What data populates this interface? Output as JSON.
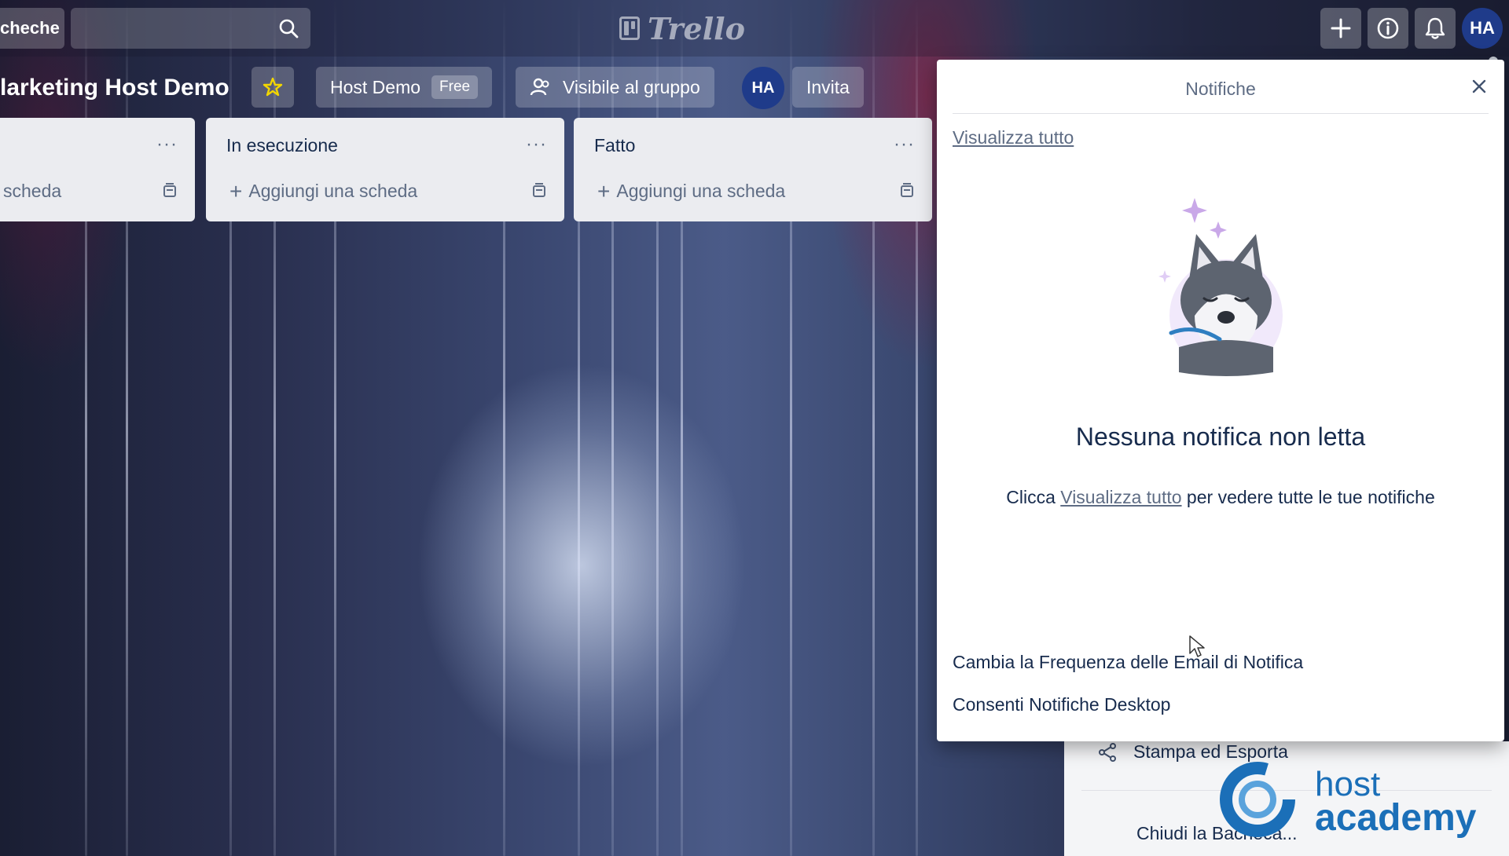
{
  "topbar": {
    "boards_label": "cheche",
    "logo_text": "Trello",
    "avatar_initials": "HA",
    "icons": [
      "search-icon",
      "plus-icon",
      "info-icon",
      "bell-icon"
    ]
  },
  "board": {
    "title": "larketing Host Demo",
    "workspace_label": "Host Demo",
    "workspace_badge": "Free",
    "visibility_label": "Visibile al gruppo",
    "member_initials": "HA",
    "invite_label": "Invita"
  },
  "lists": [
    {
      "title": "",
      "add_card_label": "scheda"
    },
    {
      "title": "In esecuzione",
      "add_card_label": "Aggiungi una scheda"
    },
    {
      "title": "Fatto",
      "add_card_label": "Aggiungi una scheda"
    }
  ],
  "notifications": {
    "title": "Notifiche",
    "view_all": "Visualizza tutto",
    "empty_title": "Nessuna notifica non letta",
    "empty_sub_prefix": "Clicca ",
    "empty_sub_link": "Visualizza tutto",
    "empty_sub_suffix": " per vedere tutte le tue notifiche",
    "option_email_frequency": "Cambia la Frequenza delle Email di Notifica",
    "option_desktop": "Consenti Notifiche Desktop"
  },
  "side_menu": {
    "print_export": "Stampa ed Esporta",
    "close_board": "Chiudi la Bacheca..."
  },
  "watermark": {
    "line1": "host",
    "line2": "academy"
  },
  "colors": {
    "accent_red": "#e03a5e",
    "avatar_blue": "#1f3b8a",
    "watermark_blue": "#1b6fb8"
  }
}
